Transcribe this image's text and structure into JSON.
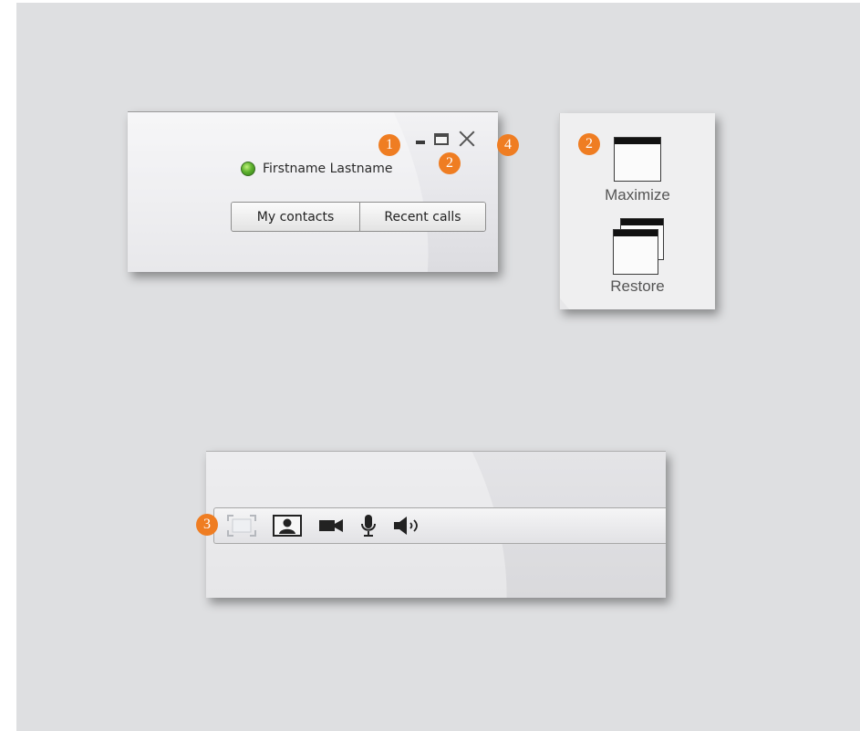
{
  "window": {
    "user_name": "Firstname Lastname",
    "presence_color": "#5fb22f",
    "tabs": [
      {
        "label": "My contacts"
      },
      {
        "label": "Recent calls"
      }
    ]
  },
  "callouts": {
    "minimize": "1",
    "maximize": "2",
    "fullscreen": "3",
    "close": "4",
    "legend": "2"
  },
  "legend": {
    "maximize_label": "Maximize",
    "restore_label": "Restore"
  },
  "toolbar": {
    "icons": [
      "fullscreen-icon",
      "selfview-icon",
      "camera-icon",
      "microphone-icon",
      "speaker-icon"
    ]
  },
  "colors": {
    "callout": "#ef7d22",
    "background": "#dedfe1"
  }
}
